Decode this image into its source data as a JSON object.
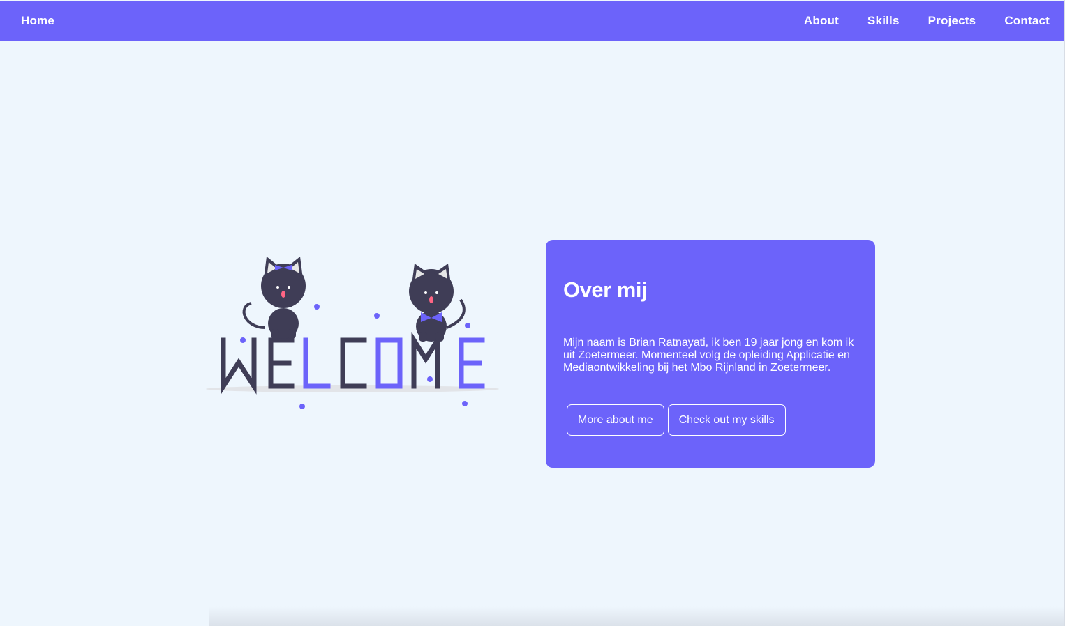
{
  "nav": {
    "home_label": "Home",
    "links": [
      "About",
      "Skills",
      "Projects",
      "Contact"
    ]
  },
  "hero": {
    "illustration_text": "WELCOME",
    "illustration_icon": "welcome-cats-illustration"
  },
  "card": {
    "title": "Over mij",
    "text": "Mijn naam is Brian Ratnayati, ik ben 19 jaar jong en kom ik uit Zoetermeer. Momenteel volg de opleiding Applicatie en Mediaontwikkeling bij het Mbo Rijnland in Zoetermeer.",
    "buttons": [
      "More about me",
      "Check out my skills"
    ]
  },
  "colors": {
    "accent": "#6c63fa",
    "background": "#eef6fd",
    "dark": "#3f3d56"
  }
}
